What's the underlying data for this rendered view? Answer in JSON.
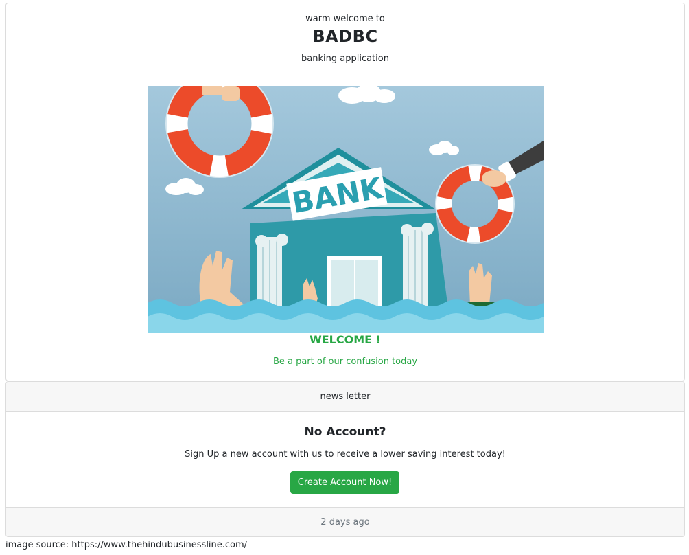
{
  "header": {
    "welcome_small": "warm welcome to",
    "brand": "BADBC",
    "subtitle": "banking application"
  },
  "hero": {
    "image_icon": "bank-rescue-illustration",
    "bank_sign": "BANK",
    "welcome_title": "WELCOME !",
    "welcome_text": "Be a part of our confusion today"
  },
  "newsletter": {
    "header": "news letter",
    "title": "No Account?",
    "text": "Sign Up a new account with us to receive a lower saving interest today!",
    "button_label": "Create Account Now!",
    "footer": "2 days ago"
  },
  "footer": {
    "source_text": "image source: https://www.thehindubusinessline.com/"
  },
  "colors": {
    "accent_green": "#28a745",
    "sky": "#8fb9cf",
    "water": "#5ec3e0",
    "bank_teal": "#2aa1b0"
  }
}
